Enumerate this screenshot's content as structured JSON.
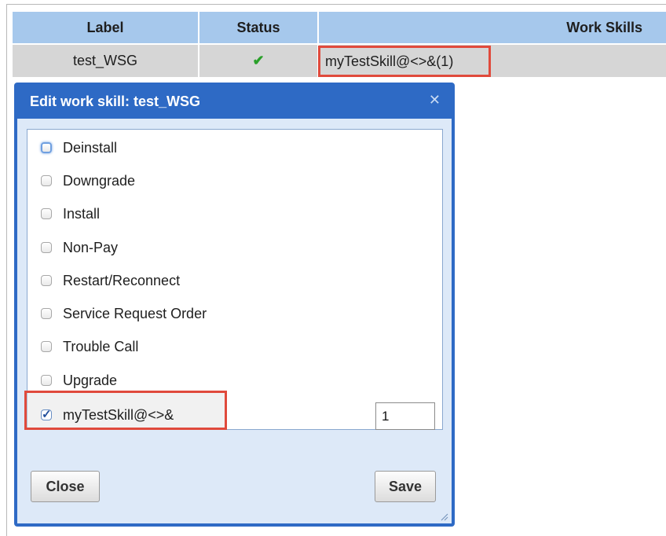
{
  "table": {
    "headers": {
      "label": "Label",
      "status": "Status",
      "work_skills": "Work Skills"
    },
    "rows": [
      {
        "label": "test_WSG",
        "status_icon": "check-icon",
        "work_skills": "myTestSkill@<>&(1)"
      }
    ]
  },
  "dialog": {
    "title": "Edit work skill: test_WSG",
    "close_icon": "close-icon",
    "skills": [
      {
        "label": "Deinstall",
        "checked": false
      },
      {
        "label": "Downgrade",
        "checked": false
      },
      {
        "label": "Install",
        "checked": false
      },
      {
        "label": "Non-Pay",
        "checked": false
      },
      {
        "label": "Restart/Reconnect",
        "checked": false
      },
      {
        "label": "Service Request Order",
        "checked": false
      },
      {
        "label": "Trouble Call",
        "checked": false
      },
      {
        "label": "Upgrade",
        "checked": false
      },
      {
        "label": "myTestSkill@<>&",
        "checked": true,
        "qualification": "1"
      }
    ],
    "close_button": "Close",
    "save_button": "Save"
  },
  "colors": {
    "header_bg": "#a6c8ec",
    "row_bg": "#d6d6d6",
    "dialog_blue": "#2e6ac5",
    "highlight_red": "#e04a3c",
    "check_green": "#2aa02a"
  }
}
